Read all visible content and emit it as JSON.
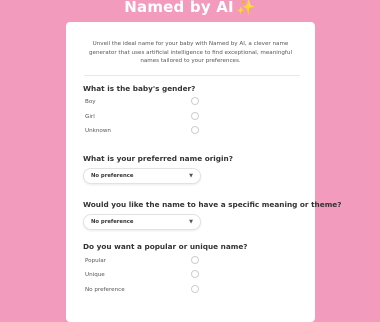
{
  "app": {
    "title": "Named by AI",
    "title_icon": "sparkles-icon"
  },
  "intro": "Unveil the ideal name for your baby with Named by AI, a clever name generator that uses artificial intelligence to find exceptional, meaningful names tailored to your preferences.",
  "questions": {
    "gender": {
      "label": "What is the baby's gender?",
      "options": [
        "Boy",
        "Girl",
        "Unknown"
      ]
    },
    "origin": {
      "label": "What is your preferred name origin?",
      "selected": "No preference"
    },
    "meaning": {
      "label": "Would you like the name to have a specific meaning or theme?",
      "selected": "No preference"
    },
    "popularity": {
      "label": "Do you want a popular or unique name?",
      "options": [
        "Popular",
        "Unique",
        "No preference"
      ]
    }
  },
  "colors": {
    "background": "#f29bbd",
    "card": "#ffffff",
    "sparkle": "#f7c84a"
  }
}
